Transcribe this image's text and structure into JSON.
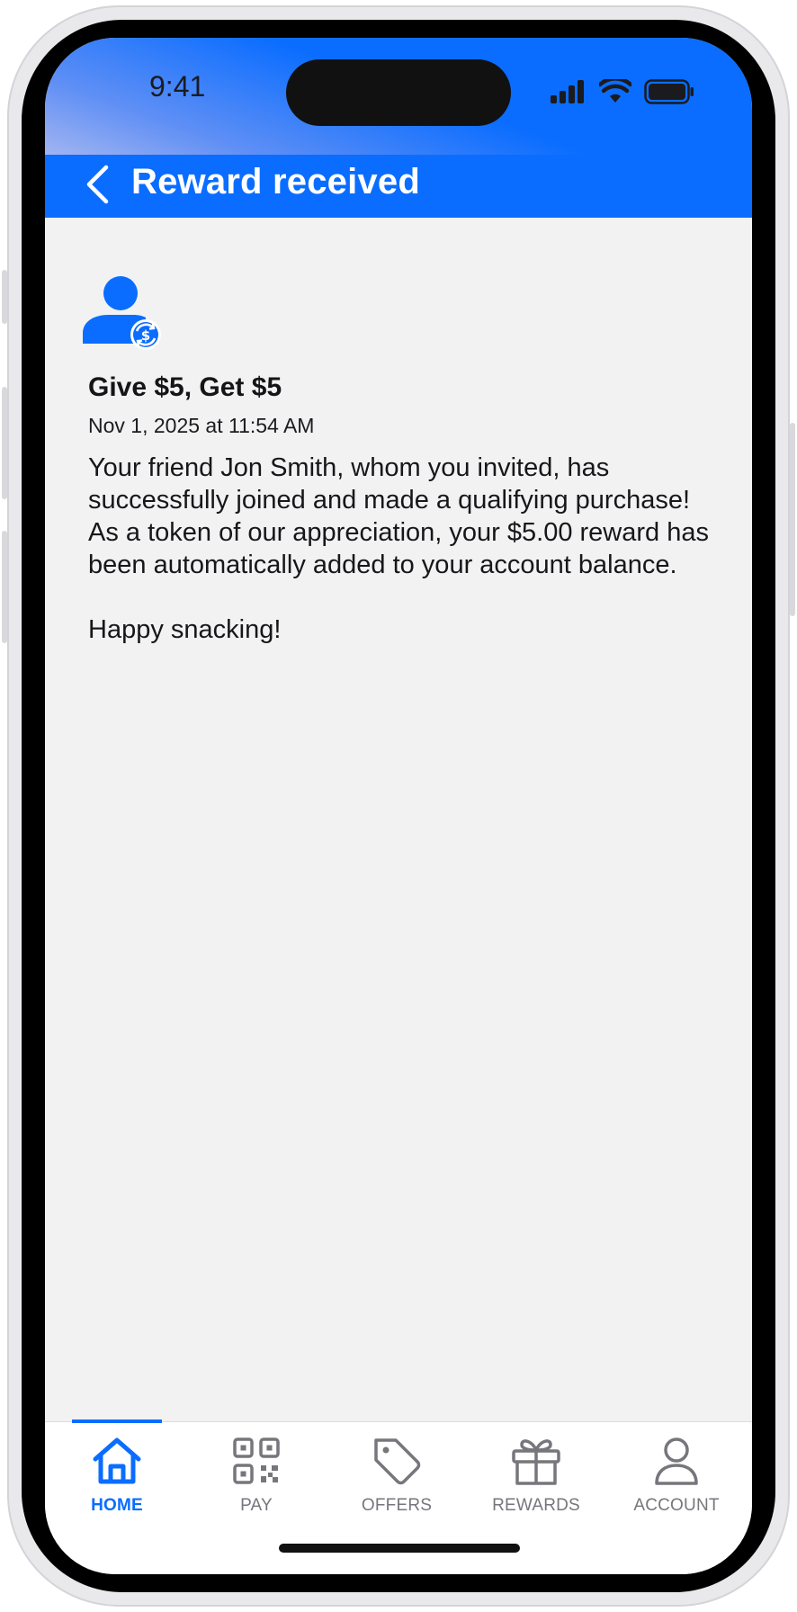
{
  "status_bar": {
    "time": "9:41"
  },
  "header": {
    "title": "Reward received"
  },
  "notification": {
    "title": "Give $5, Get $5",
    "date": "Nov 1, 2025 at 11:54 AM",
    "body": [
      "Your friend Jon Smith, whom you invited, has successfully joined and made a qualifying purchase! As a token of our appreciation, your $5.00 reward has been automatically added to your account balance.",
      "Happy snacking!"
    ]
  },
  "tabbar": {
    "active": "home",
    "items": [
      {
        "id": "home",
        "label": "HOME"
      },
      {
        "id": "pay",
        "label": "PAY"
      },
      {
        "id": "offers",
        "label": "OFFERS"
      },
      {
        "id": "rewards",
        "label": "REWARDS"
      },
      {
        "id": "account",
        "label": "ACCOUNT"
      }
    ]
  },
  "colors": {
    "brand": "#0a6dff",
    "tab_inactive": "#76767c",
    "background": "#f2f2f3"
  },
  "icons": {
    "back": "chevron-left-icon",
    "avatar": "user-refresh-dollar-icon",
    "home": "home-icon",
    "pay": "qr-code-icon",
    "offers": "tag-icon",
    "rewards": "gift-icon",
    "account": "person-icon"
  }
}
